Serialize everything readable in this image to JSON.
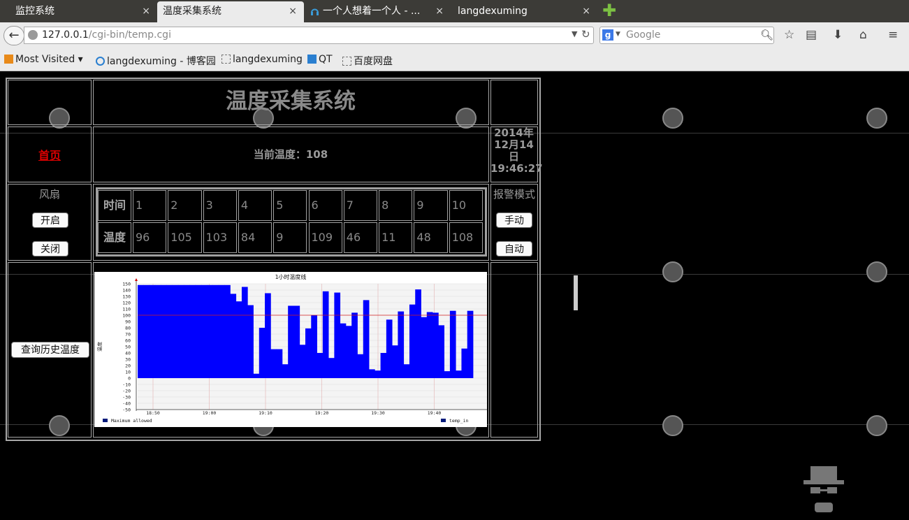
{
  "browser": {
    "tabs": [
      {
        "label": "监控系统",
        "active": false
      },
      {
        "label": "温度采集系统",
        "active": true
      },
      {
        "label": "一个人想着一个人 - ...",
        "active": false
      },
      {
        "label": "langdexuming",
        "active": false
      }
    ],
    "close_glyph": "×",
    "new_tab_glyph": "✚",
    "url_host": "127.0.0.1",
    "url_path": "/cgi-bin/temp.cgi",
    "search_placeholder": "Google",
    "bookmarks": [
      {
        "label": "Most Visited ▾",
        "icon": "folder-icon"
      },
      {
        "label": "langdexuming - 博客园",
        "icon": "blog-icon"
      },
      {
        "label": "langdexuming",
        "icon": "page-icon"
      },
      {
        "label": "QT",
        "icon": "qt-icon"
      },
      {
        "label": "百度网盘",
        "icon": "page-icon"
      }
    ]
  },
  "page": {
    "title": "温度采集系统",
    "home_link": "首页",
    "current_temp_label": "当前温度：108",
    "datetime_lines": [
      "2014年",
      "12月14",
      "日",
      "19:46:27"
    ],
    "fan_label": "风扇",
    "fan_on": "开启",
    "fan_off": "关闭",
    "alarm_label": "报警模式",
    "alarm_manual": "手动",
    "alarm_auto": "自动",
    "history_button": "查询历史温度",
    "table": {
      "time_header": "时间",
      "temp_header": "温度",
      "times": [
        "1",
        "2",
        "3",
        "4",
        "5",
        "6",
        "7",
        "8",
        "9",
        "10"
      ],
      "temps": [
        "96",
        "105",
        "103",
        "84",
        "9",
        "109",
        "46",
        "11",
        "48",
        "108"
      ]
    }
  },
  "chart_data": {
    "type": "area",
    "title": "1小时温度线",
    "ylabel": "温度",
    "ylim": [
      -50,
      150
    ],
    "yticks": [
      -50,
      -40,
      -30,
      -20,
      -10,
      0,
      10,
      20,
      30,
      40,
      50,
      60,
      70,
      80,
      90,
      100,
      110,
      120,
      130,
      140,
      150
    ],
    "xticks": [
      "18:50",
      "19:00",
      "19:10",
      "19:20",
      "19:30",
      "19:40"
    ],
    "threshold": 100,
    "legend": [
      "Maximum allowed",
      "temp_in"
    ],
    "colors": {
      "fill": "#0000ff",
      "threshold": "#d02020"
    },
    "series": [
      {
        "name": "temp_in",
        "values": [
          148,
          148,
          148,
          148,
          148,
          148,
          148,
          148,
          148,
          148,
          148,
          148,
          148,
          148,
          148,
          148,
          134,
          122,
          145,
          116,
          7,
          80,
          135,
          46,
          46,
          22,
          115,
          115,
          53,
          79,
          100,
          40,
          138,
          32,
          136,
          87,
          83,
          104,
          38,
          124,
          14,
          12,
          40,
          93,
          52,
          106,
          22,
          117,
          141,
          97,
          105,
          104,
          84,
          11,
          107,
          12,
          47,
          107
        ]
      }
    ]
  }
}
